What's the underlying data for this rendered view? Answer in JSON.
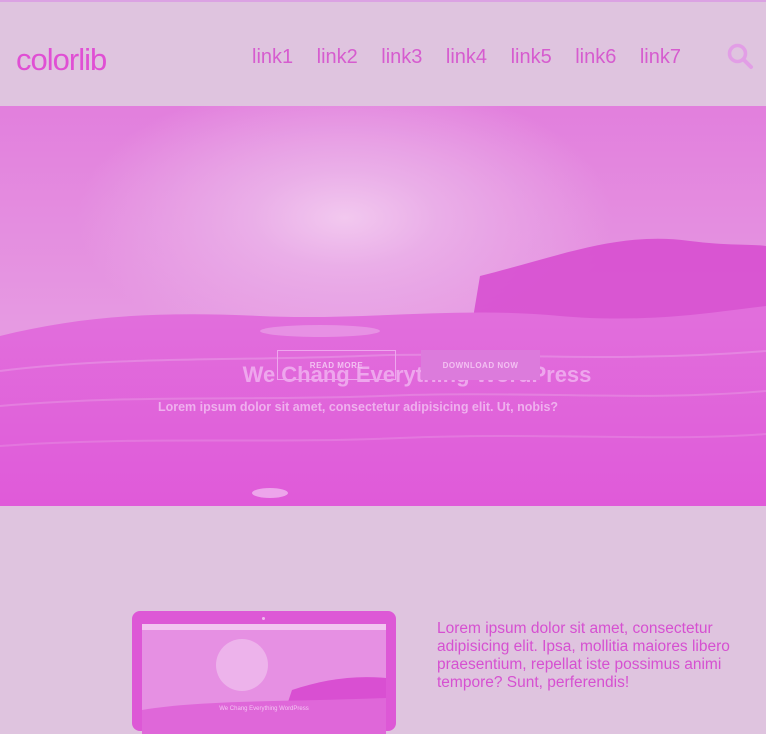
{
  "header": {
    "logo": "colorlib",
    "nav": [
      "link1",
      "link2",
      "link3",
      "link4",
      "link5",
      "link6",
      "link7"
    ]
  },
  "hero": {
    "title": "We Chang Everything WordPress",
    "subtitle": "Lorem ipsum dolor sit amet, consectetur adipisicing elit. Ut, nobis?",
    "read_more": "READ MORE",
    "download": "DOWNLOAD NOW"
  },
  "feature": {
    "text": "Lorem ipsum dolor sit amet, consectetur adipisicing elit. Ipsa, mollitia maiores libero praesentium, repellat iste possimus animi tempore? Sunt, perferendis!"
  },
  "colors": {
    "background": "#dfc4df",
    "accent": "#e04fd4",
    "hero_tint": "#e070dc"
  }
}
